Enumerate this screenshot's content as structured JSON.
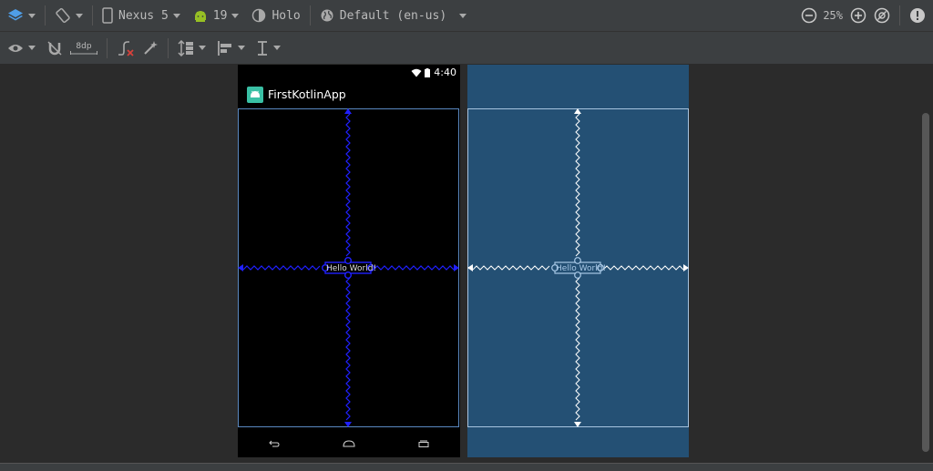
{
  "toolbar": {
    "device_label": "Nexus 5",
    "api_label": "19",
    "theme_label": "Holo",
    "locale_label": "Default (en-us)",
    "zoom_label": "25%"
  },
  "toolbar2": {
    "margin_label": "8dp"
  },
  "device": {
    "time": "4:40",
    "app_title": "FirstKotlinApp",
    "hello_text": "Hello World!"
  },
  "blueprint": {
    "hello_text": "Hello World!"
  },
  "colors": {
    "toolbar_bg": "#3c3f41",
    "canvas_bg": "#2b2b2b",
    "blueprint_bg": "#245074",
    "constraint_blue": "#1f1fff",
    "app_icon": "#3ac0a5"
  }
}
